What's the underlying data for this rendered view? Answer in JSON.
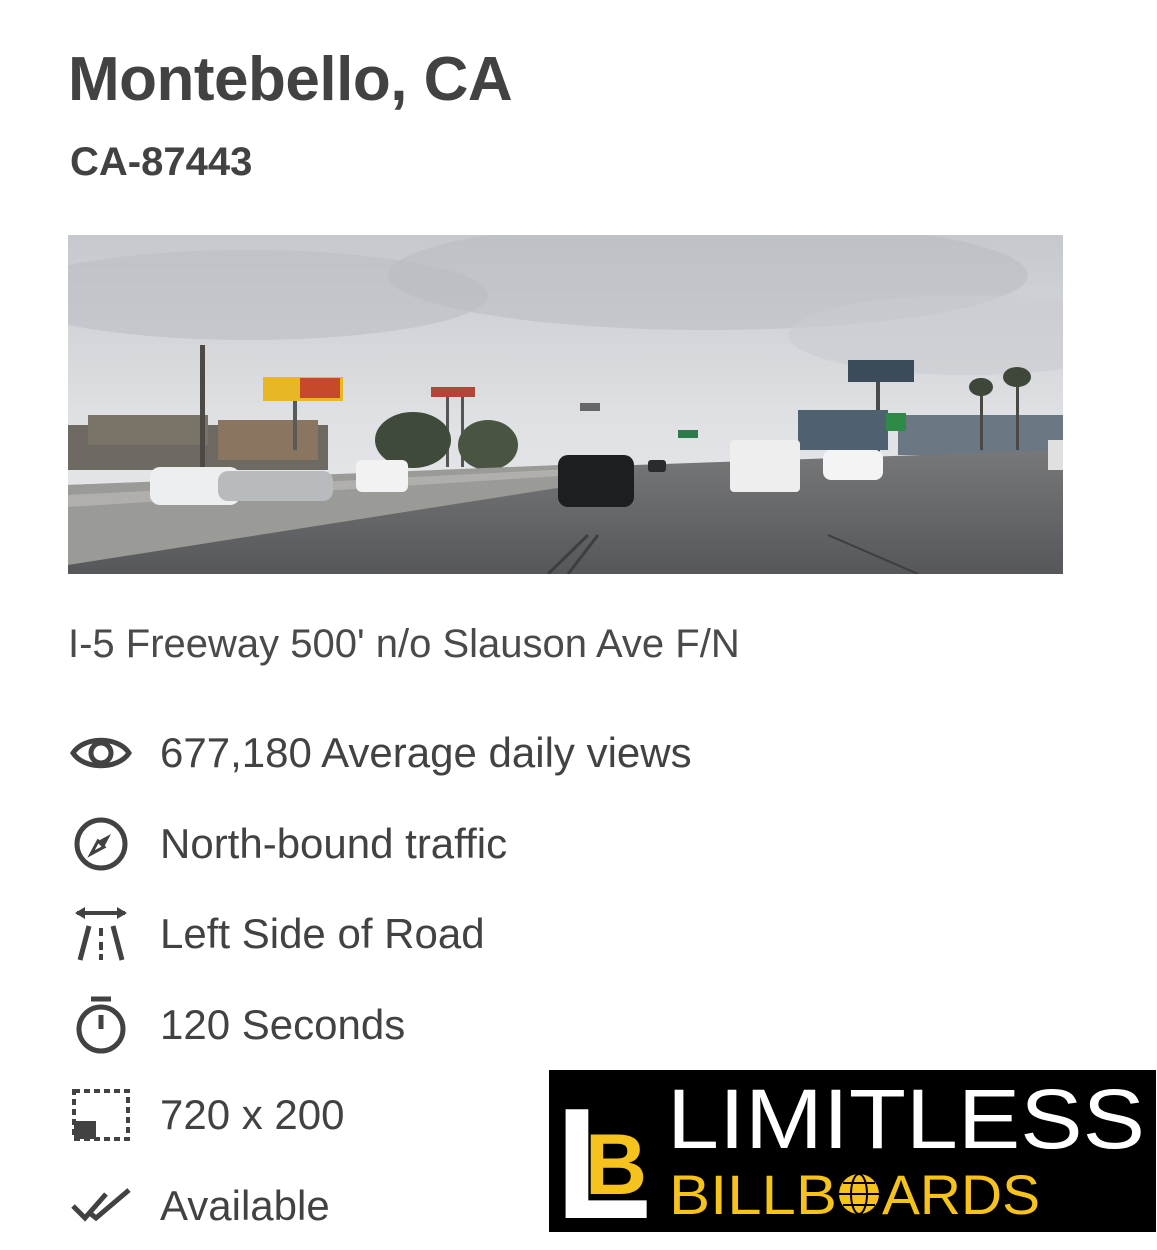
{
  "listing": {
    "title": "Montebello, CA",
    "code": "CA-87443",
    "address": "I-5 Freeway 500' n/o Slauson Ave F/N",
    "photo": {
      "content": "freeway-traffic-billboard-photo"
    }
  },
  "features": [
    {
      "icon": "eye-icon",
      "label": "677,180 Average daily views"
    },
    {
      "icon": "compass-icon",
      "label": "North-bound traffic"
    },
    {
      "icon": "road-side-icon",
      "label": "Left Side of Road"
    },
    {
      "icon": "stopwatch-icon",
      "label": "120 Seconds"
    },
    {
      "icon": "dimensions-icon",
      "label": "720 x 200"
    },
    {
      "icon": "double-check-icon",
      "label": "Available"
    }
  ],
  "logo": {
    "monogram_l": "L",
    "monogram_b": "B",
    "line1": "LIMITLESS",
    "line2": "BILLBOARDS",
    "line2_before_o": "BILLB",
    "line2_after_o": "ARDS",
    "colors": {
      "background": "#000000",
      "white": "#ffffff",
      "yellow": "#f5c31c"
    }
  },
  "colors": {
    "text": "#424242",
    "background": "#ffffff"
  }
}
